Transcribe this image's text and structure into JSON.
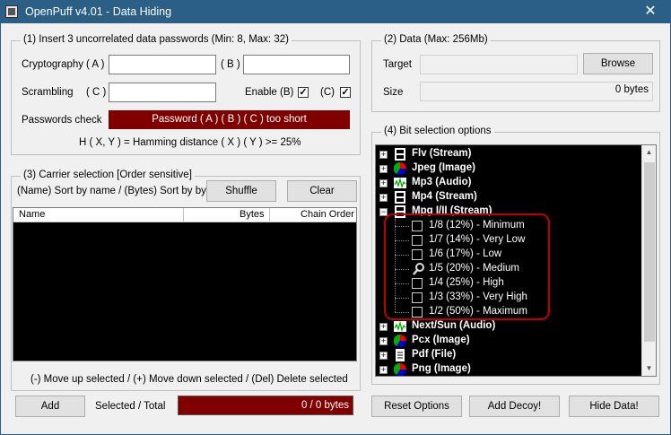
{
  "window": {
    "title": "OpenPuff v4.01 - Data Hiding",
    "close": "✕"
  },
  "passwords": {
    "legend": "(1)  Insert 3 uncorrelated data passwords (Min: 8, Max: 32)",
    "cryptography_label": "Cryptography",
    "a_label": "( A )",
    "b_label": "( B )",
    "scrambling_label": "Scrambling",
    "c_label": "( C )",
    "enable_b_label": "Enable (B)",
    "enable_c_label": "(C)",
    "enable_b_checked": "✓",
    "enable_c_checked": "✓",
    "check_label": "Passwords check",
    "check_status": "Password ( A ) ( B ) ( C ) too short",
    "hamming_note": "H ( X, Y )  =  Hamming distance ( X ) ( Y )  >=  25%",
    "status_color": "#800000"
  },
  "data": {
    "legend": "(2)  Data (Max: 256Mb)",
    "target_label": "Target",
    "browse_label": "Browse",
    "size_label": "Size",
    "size_value": "0 bytes"
  },
  "carrier": {
    "legend": "(3)  Carrier selection [Order sensitive]",
    "sort_hint": "(Name) Sort by name / (Bytes) Sort by bytes",
    "shuffle_label": "Shuffle",
    "clear_label": "Clear",
    "columns": [
      "Name",
      "Bytes",
      "Chain Order"
    ],
    "move_hint": "(-) Move up selected / (+) Move down selected / (Del) Delete selected",
    "add_label": "Add",
    "selected_total_label": "Selected / Total",
    "selected_total_value": "0 / 0 bytes"
  },
  "bits": {
    "legend": "(4)  Bit selection options",
    "items": [
      {
        "label": "Flv (Stream)",
        "icon": "film-icon",
        "expander": "+"
      },
      {
        "label": "Jpeg (Image)",
        "icon": "color-pie-icon",
        "expander": "+"
      },
      {
        "label": "Mp3 (Audio)",
        "icon": "waveform-icon",
        "expander": "+"
      },
      {
        "label": "Mp4 (Stream)",
        "icon": "film-icon",
        "expander": "+"
      },
      {
        "label": "Mpg I/II (Stream)",
        "icon": "film-icon",
        "expander": "−"
      },
      {
        "label": "Next/Sun (Audio)",
        "icon": "waveform-icon",
        "expander": "+"
      },
      {
        "label": "Pcx (Image)",
        "icon": "color-pie-icon",
        "expander": "+"
      },
      {
        "label": "Pdf (File)",
        "icon": "document-icon",
        "expander": "+"
      },
      {
        "label": "Png (Image)",
        "icon": "color-pie-icon",
        "expander": "+"
      }
    ],
    "options": [
      "1/8 (12%) - Minimum",
      "1/7 (14%) - Very Low",
      "1/6 (17%) - Low",
      "1/5 (20%) - Medium",
      "1/4 (25%) - High",
      "1/3 (33%) - Very High",
      "1/2 (50%) - Maximum"
    ],
    "selected_option_index": 3,
    "highlight_color": "#c00000"
  },
  "actions": {
    "reset_label": "Reset Options",
    "decoy_label": "Add Decoy!",
    "hide_label": "Hide Data!"
  }
}
